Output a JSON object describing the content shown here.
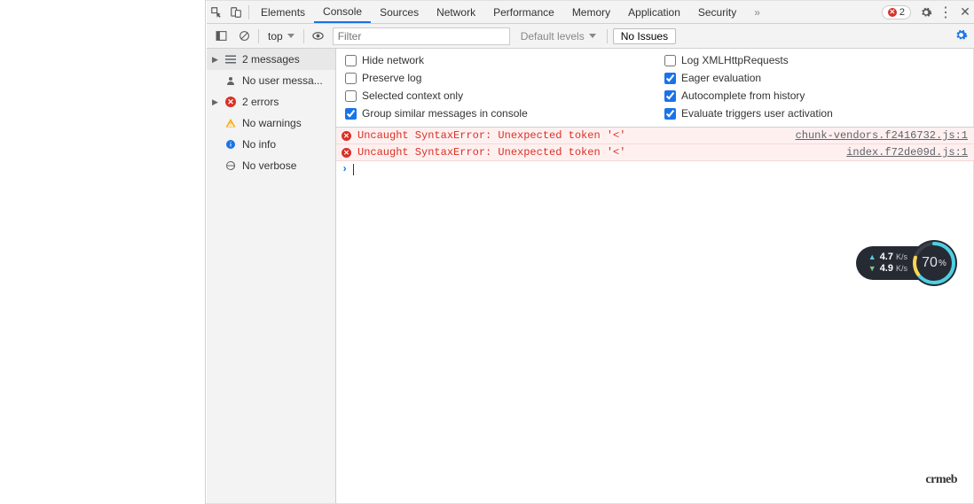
{
  "tabs": {
    "elements": "Elements",
    "console": "Console",
    "sources": "Sources",
    "network": "Network",
    "performance": "Performance",
    "memory": "Memory",
    "application": "Application",
    "security": "Security"
  },
  "error_count": "2",
  "toolbar": {
    "context": "top",
    "filter_placeholder": "Filter",
    "levels": "Default levels",
    "issues_btn": "No Issues"
  },
  "sidebar": {
    "messages": "2 messages",
    "user_messages": "No user messa...",
    "errors": "2 errors",
    "warnings": "No warnings",
    "info": "No info",
    "verbose": "No verbose"
  },
  "settings": {
    "hide_network": "Hide network",
    "log_xhr": "Log XMLHttpRequests",
    "preserve_log": "Preserve log",
    "eager_eval": "Eager evaluation",
    "selected_ctx": "Selected context only",
    "autocomplete": "Autocomplete from history",
    "group_similar": "Group similar messages in console",
    "eval_triggers": "Evaluate triggers user activation"
  },
  "logs": [
    {
      "msg": "Uncaught SyntaxError: Unexpected token '<'",
      "src": "chunk-vendors.f2416732.js:1"
    },
    {
      "msg": "Uncaught SyntaxError: Unexpected token '<'",
      "src": "index.f72de09d.js:1"
    }
  ],
  "net_widget": {
    "up": "4.7",
    "up_unit": "K/s",
    "down": "4.9",
    "down_unit": "K/s",
    "pct": "70"
  },
  "watermark": "crmeb"
}
